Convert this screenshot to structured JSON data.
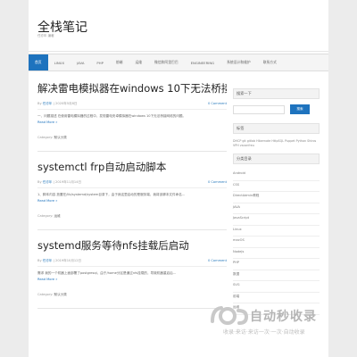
{
  "header": {
    "title": "全栈笔记",
    "description": "任亦年 编著"
  },
  "nav": {
    "items": [
      "首页",
      "LINUX",
      "JAVA",
      "PHP",
      "前端",
      "运维",
      "微信和阿里巴巴",
      "ENGINEERING",
      "系统设计和维护",
      "联系方式"
    ]
  },
  "posts": [
    {
      "title": "解决雷电模拟器在windows 10下无法桥接网卡的问题",
      "author": "任亦年",
      "date": "2020年5月8日",
      "comments": "0 Comment",
      "excerpt": "一、问题描述 在使用雷电模拟器的过程中，发现雷电安卓模拟器在windows 10下无法桥接网络的问题。",
      "read_more": "Read More »",
      "category_label": "Category:",
      "category": "默认分类"
    },
    {
      "title": "systemctl frp自动启动脚本",
      "author": "任亦年",
      "date": "2019年11月14日",
      "comments": "0 Comment",
      "excerpt": "1、脚本内容 放置在/lib/systemd/system目录下，由于我这里启动的是服务端，我将该脚本文件命名...",
      "read_more": "Read More »",
      "category_label": "Category:",
      "category": "运维"
    },
    {
      "title": "systemd服务等待nfs挂载后启动",
      "author": "任亦年",
      "date": "2019年10月12日",
      "comments": "0 Comment",
      "excerpt": "需求 我的一个机器上面部署了postgresql，由于/home分区是通过nfs挂载的，导致机器重启后...",
      "read_more": "Read More »",
      "category_label": "Category:",
      "category": "默认分类"
    }
  ],
  "sidebar": {
    "search_title": "搜索一下",
    "search_placeholder": "",
    "search_button": "搜索",
    "tags_title": "标签",
    "tags_text": "DHCP git gitlab Hibernate HttpSQL Puppet Python Shiros VPH vsconfreu",
    "categories_title": "分类目录",
    "categories": [
      "Android",
      "CSS",
      "DirectAdmin教程",
      "JAVA",
      "JavaScript",
      "Linux",
      "macOS",
      "NodeJs",
      "PHP",
      "数据",
      "SVG",
      "前端",
      "运维"
    ]
  },
  "watermark": {
    "text": "自动秒收录",
    "sub": "收录·来访·来访一次·一次·自动收录"
  }
}
